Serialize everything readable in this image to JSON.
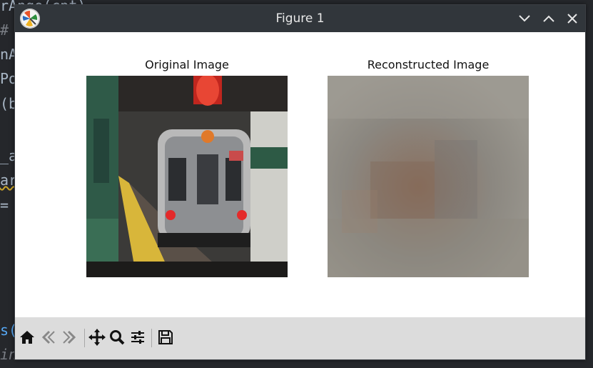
{
  "editor": {
    "lines": [
      "rAnge(cpt)",
      "#",
      "nA",
      "Po",
      "(b",
      "_a",
      "ar",
      "=",
      "s(",
      "in"
    ]
  },
  "window": {
    "title": "Figure 1",
    "controls": [
      "chevron-down-icon",
      "chevron-up-icon",
      "close-icon"
    ]
  },
  "figure": {
    "left_title": "Original Image",
    "right_title": "Reconstructed Image"
  },
  "toolbar": {
    "tools": [
      "home-icon",
      "back-arrow-icon",
      "forward-arrow-icon",
      "pan-move-icon",
      "zoom-icon",
      "configure-subplots-icon",
      "save-icon"
    ]
  },
  "colors": {
    "titlebar": "#31363b",
    "toolbar": "#dcdcdc",
    "canvas": "#ffffff"
  }
}
